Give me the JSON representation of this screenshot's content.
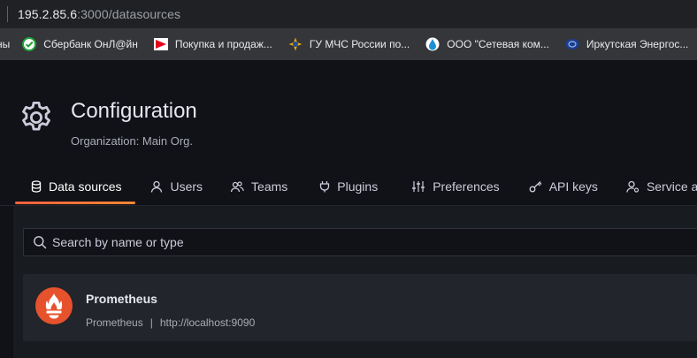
{
  "browser": {
    "url_host": "195.2.85.6",
    "url_path": ":3000/datasources"
  },
  "bookmarks": [
    {
      "label": "ны",
      "icon": "none"
    },
    {
      "label": "Сбербанк ОнЛ@йн",
      "icon": "sberbank-icon"
    },
    {
      "label": "Покупка и продаж...",
      "icon": "red-arrow-icon"
    },
    {
      "label": "ГУ МЧС России по...",
      "icon": "mchs-emblem-icon"
    },
    {
      "label": "ООО \"Сетевая ком...",
      "icon": "drop-emblem-icon"
    },
    {
      "label": "Иркутская Энергос...",
      "icon": "energy-logo-icon"
    }
  ],
  "header": {
    "title": "Configuration",
    "subtitle": "Organization: Main Org."
  },
  "tabs": [
    {
      "label": "Data sources",
      "icon": "database-icon",
      "active": true
    },
    {
      "label": "Users",
      "icon": "user-icon",
      "active": false
    },
    {
      "label": "Teams",
      "icon": "users-icon",
      "active": false
    },
    {
      "label": "Plugins",
      "icon": "plug-icon",
      "active": false
    },
    {
      "label": "Preferences",
      "icon": "sliders-icon",
      "active": false
    },
    {
      "label": "API keys",
      "icon": "key-icon",
      "active": false
    },
    {
      "label": "Service a",
      "icon": "user-gear-icon",
      "active": false
    }
  ],
  "search": {
    "placeholder": "Search by name or type",
    "value": ""
  },
  "datasources": [
    {
      "name": "Prometheus",
      "type": "Prometheus",
      "url": "http://localhost:9090",
      "separator": "|"
    }
  ],
  "colors": {
    "accent": "#f55f3e",
    "background": "#111217",
    "panel": "#181b1f",
    "card": "#22252b"
  }
}
